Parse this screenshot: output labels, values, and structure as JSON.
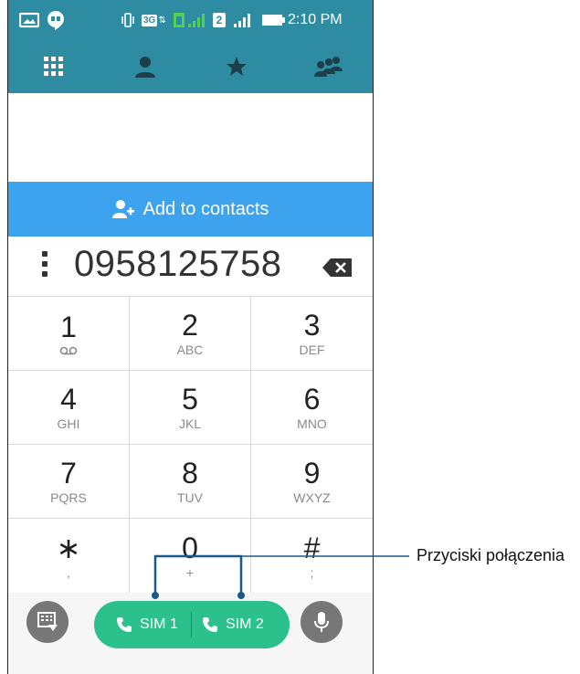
{
  "status_bar": {
    "time": "2:10 PM",
    "network_label": "3G",
    "sim_badge": "2"
  },
  "nav": {
    "tabs": [
      {
        "icon": "dialpad-grid-icon"
      },
      {
        "icon": "person-icon"
      },
      {
        "icon": "star-icon"
      },
      {
        "icon": "group-icon"
      }
    ]
  },
  "add_contacts_label": "Add to contacts",
  "dialed_number": "0958125758",
  "keypad": [
    {
      "digit": "1",
      "letters": ""
    },
    {
      "digit": "2",
      "letters": "ABC"
    },
    {
      "digit": "3",
      "letters": "DEF"
    },
    {
      "digit": "4",
      "letters": "GHI"
    },
    {
      "digit": "5",
      "letters": "JKL"
    },
    {
      "digit": "6",
      "letters": "MNO"
    },
    {
      "digit": "7",
      "letters": "PQRS"
    },
    {
      "digit": "8",
      "letters": "TUV"
    },
    {
      "digit": "9",
      "letters": "WXYZ"
    },
    {
      "digit": "∗",
      "letters": ","
    },
    {
      "digit": "0",
      "letters": "+"
    },
    {
      "digit": "#",
      "letters": ";"
    }
  ],
  "call_buttons": {
    "sim1": "SIM 1",
    "sim2": "SIM 2"
  },
  "callout": "Przyciski połączenia",
  "colors": {
    "header": "#2d8ca1",
    "add_contacts": "#3ea3ef",
    "call_pill": "#2cc08d",
    "round_buttons": "#777777"
  }
}
